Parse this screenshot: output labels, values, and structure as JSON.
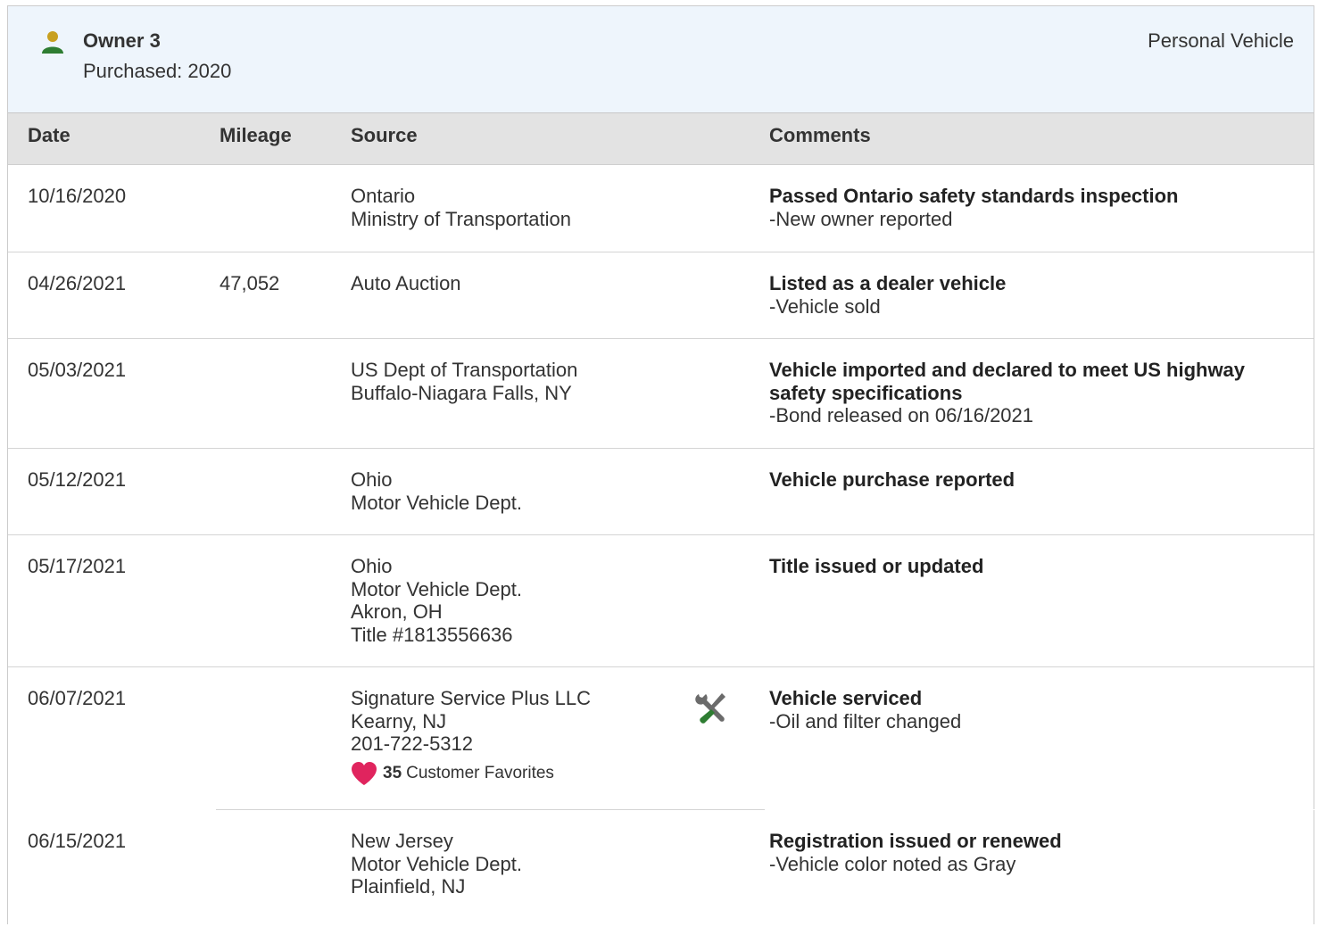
{
  "owner": {
    "title": "Owner 3",
    "purchased": "Purchased: 2020",
    "vehicle_type": "Personal Vehicle",
    "icon": "person-icon",
    "icon_color": "#2e7d32",
    "icon_head_color": "#c8a020"
  },
  "columns": {
    "date": "Date",
    "mileage": "Mileage",
    "source": "Source",
    "comments": "Comments"
  },
  "rows": [
    {
      "date": "10/16/2020",
      "mileage": "",
      "source": [
        "Ontario",
        "Ministry of Transportation"
      ],
      "comment_title": "Passed Ontario safety standards inspection",
      "comment_sub": "-New owner reported"
    },
    {
      "date": "04/26/2021",
      "mileage": "47,052",
      "source": [
        "Auto Auction"
      ],
      "comment_title": "Listed as a dealer vehicle",
      "comment_sub": "-Vehicle sold"
    },
    {
      "date": "05/03/2021",
      "mileage": "",
      "source": [
        "US Dept of Transportation",
        "Buffalo-Niagara Falls, NY"
      ],
      "comment_title": "Vehicle imported and declared to meet US highway safety specifications",
      "comment_sub": "-Bond released on 06/16/2021"
    },
    {
      "date": "05/12/2021",
      "mileage": "",
      "source": [
        "Ohio",
        "Motor Vehicle Dept."
      ],
      "comment_title": "Vehicle purchase reported",
      "comment_sub": ""
    },
    {
      "date": "05/17/2021",
      "mileage": "",
      "source": [
        "Ohio",
        "Motor Vehicle Dept.",
        "Akron, OH",
        "Title #1813556636"
      ],
      "comment_title": "Title issued or updated",
      "comment_sub": ""
    },
    {
      "date": "06/07/2021",
      "mileage": "",
      "source": [
        "Signature Service Plus LLC",
        "Kearny, NJ",
        "201-722-5312"
      ],
      "favorites_count": "35",
      "favorites_label": "Customer Favorites",
      "service_icon": "wrench-screwdriver-icon",
      "comment_title": "Vehicle serviced",
      "comment_sub": "-Oil and filter changed"
    },
    {
      "date": "06/15/2021",
      "mileage": "",
      "source": [
        "New Jersey",
        "Motor Vehicle Dept.",
        "Plainfield, NJ"
      ],
      "comment_title": "Registration issued or renewed",
      "comment_sub": "-Vehicle color noted as Gray"
    }
  ],
  "colors": {
    "header_bg": "#eef5fc",
    "table_head_bg": "#e3e3e3",
    "heart": "#e0245e",
    "service_green": "#2e7d32",
    "service_gray": "#6b6b6b"
  }
}
